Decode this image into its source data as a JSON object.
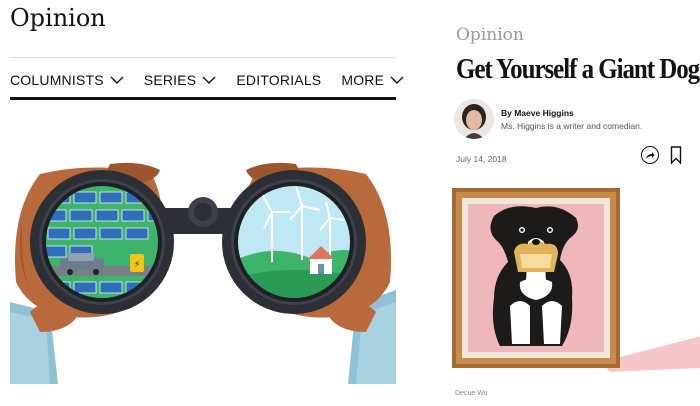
{
  "opinion_section": {
    "title": "Opinion",
    "nav": [
      {
        "label": "COLUMNISTS",
        "has_dropdown": true
      },
      {
        "label": "SERIES",
        "has_dropdown": true
      },
      {
        "label": "EDITORIALS",
        "has_dropdown": false
      },
      {
        "label": "MORE",
        "has_dropdown": true
      }
    ],
    "hero_illustration": "hands-holding-binoculars-solar-panels-wind-turbines"
  },
  "article": {
    "kicker": "Opinion",
    "headline": "Get Yourself a Giant Dog",
    "byline": "By Maeve Higgins",
    "author_bio": "Ms. Higgins is a writer and comedian.",
    "date": "July 14, 2018",
    "illustration": "framed-portrait-black-white-dog-with-toast",
    "image_credit": "Decue Wu",
    "icons": [
      "share-icon",
      "bookmark-icon"
    ]
  },
  "colors": {
    "text": "#121212",
    "rule": "#dcdcdc",
    "kicker_grey": "#9b9b9b",
    "skin": "#b86a3d",
    "binocular": "#2c2f36",
    "frame": "#a56a2f",
    "portrait_pink": "#efb7b9"
  }
}
